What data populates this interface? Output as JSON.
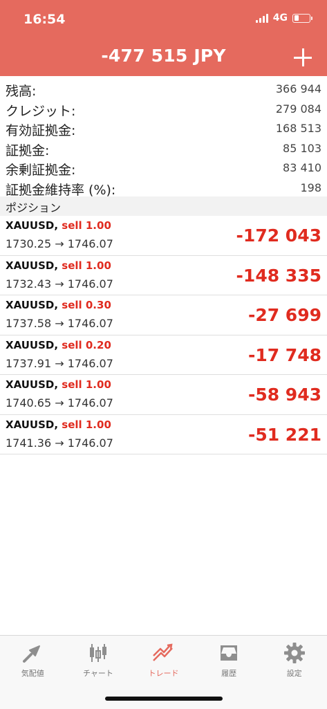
{
  "status_bar": {
    "time": "16:54",
    "network": "4G"
  },
  "header": {
    "balance": "-477 515 JPY"
  },
  "summary": [
    {
      "label": "残高:",
      "value": "366 944"
    },
    {
      "label": "クレジット:",
      "value": "279 084"
    },
    {
      "label": "有効証拠金:",
      "value": "168 513"
    },
    {
      "label": "証拠金:",
      "value": "85 103"
    },
    {
      "label": "余剰証拠金:",
      "value": "83 410"
    },
    {
      "label": "証拠金維持率 (%):",
      "value": "198"
    }
  ],
  "positions_title": "ポジション",
  "positions": [
    {
      "symbol": "XAUUSD,",
      "side": "sell 1.00",
      "prices": "1730.25 → 1746.07",
      "profit": "-172 043"
    },
    {
      "symbol": "XAUUSD,",
      "side": "sell 1.00",
      "prices": "1732.43 → 1746.07",
      "profit": "-148 335"
    },
    {
      "symbol": "XAUUSD,",
      "side": "sell 0.30",
      "prices": "1737.58 → 1746.07",
      "profit": "-27 699"
    },
    {
      "symbol": "XAUUSD,",
      "side": "sell 0.20",
      "prices": "1737.91 → 1746.07",
      "profit": "-17 748"
    },
    {
      "symbol": "XAUUSD,",
      "side": "sell 1.00",
      "prices": "1740.65 → 1746.07",
      "profit": "-58 943"
    },
    {
      "symbol": "XAUUSD,",
      "side": "sell 1.00",
      "prices": "1741.36 → 1746.07",
      "profit": "-51 221"
    }
  ],
  "tabs": [
    {
      "label": "気配値",
      "icon": "quotes-icon"
    },
    {
      "label": "チャート",
      "icon": "chart-candles-icon"
    },
    {
      "label": "トレード",
      "icon": "trade-icon",
      "active": true
    },
    {
      "label": "履歴",
      "icon": "history-inbox-icon"
    },
    {
      "label": "設定",
      "icon": "settings-gear-icon"
    }
  ],
  "colors": {
    "header": "#e56a5e",
    "loss": "#e02b1f",
    "active_tab": "#e56a5e",
    "inactive_icon": "#8e8e8e"
  }
}
